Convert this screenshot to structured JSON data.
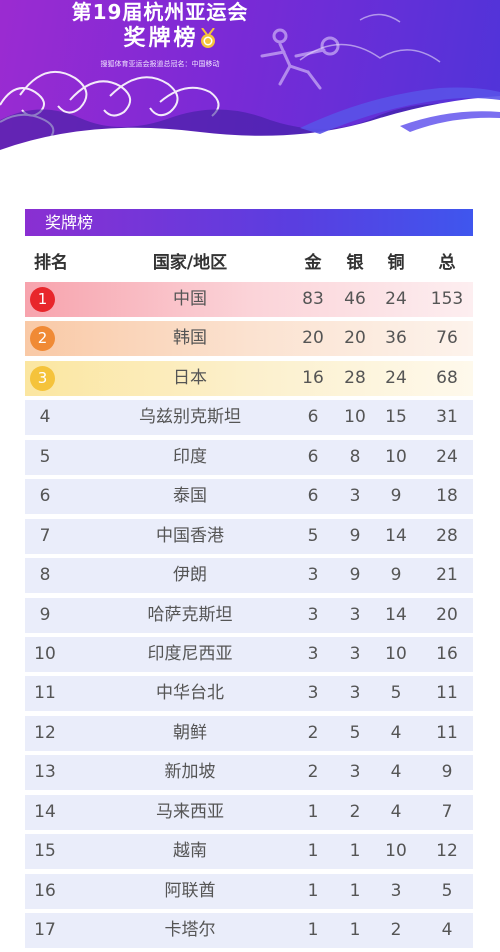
{
  "header": {
    "title": "第19届杭州亚运会",
    "subtitle": "奖牌榜",
    "sponsor": "搜狐体育亚运会报道总冠名：中国移动"
  },
  "table": {
    "title": "奖牌榜",
    "columns": {
      "rank": "排名",
      "country": "国家/地区",
      "gold": "金",
      "silver": "银",
      "bronze": "铜",
      "total": "总"
    },
    "rows": [
      {
        "rank": "1",
        "country": "中国",
        "gold": "83",
        "silver": "46",
        "bronze": "24",
        "total": "153"
      },
      {
        "rank": "2",
        "country": "韩国",
        "gold": "20",
        "silver": "20",
        "bronze": "36",
        "total": "76"
      },
      {
        "rank": "3",
        "country": "日本",
        "gold": "16",
        "silver": "28",
        "bronze": "24",
        "total": "68"
      },
      {
        "rank": "4",
        "country": "乌兹别克斯坦",
        "gold": "6",
        "silver": "10",
        "bronze": "15",
        "total": "31"
      },
      {
        "rank": "5",
        "country": "印度",
        "gold": "6",
        "silver": "8",
        "bronze": "10",
        "total": "24"
      },
      {
        "rank": "6",
        "country": "泰国",
        "gold": "6",
        "silver": "3",
        "bronze": "9",
        "total": "18"
      },
      {
        "rank": "7",
        "country": "中国香港",
        "gold": "5",
        "silver": "9",
        "bronze": "14",
        "total": "28"
      },
      {
        "rank": "8",
        "country": "伊朗",
        "gold": "3",
        "silver": "9",
        "bronze": "9",
        "total": "21"
      },
      {
        "rank": "9",
        "country": "哈萨克斯坦",
        "gold": "3",
        "silver": "3",
        "bronze": "14",
        "total": "20"
      },
      {
        "rank": "10",
        "country": "印度尼西亚",
        "gold": "3",
        "silver": "3",
        "bronze": "10",
        "total": "16"
      },
      {
        "rank": "11",
        "country": "中华台北",
        "gold": "3",
        "silver": "3",
        "bronze": "5",
        "total": "11"
      },
      {
        "rank": "12",
        "country": "朝鲜",
        "gold": "2",
        "silver": "5",
        "bronze": "4",
        "total": "11"
      },
      {
        "rank": "13",
        "country": "新加坡",
        "gold": "2",
        "silver": "3",
        "bronze": "4",
        "total": "9"
      },
      {
        "rank": "14",
        "country": "马来西亚",
        "gold": "1",
        "silver": "2",
        "bronze": "4",
        "total": "7"
      },
      {
        "rank": "15",
        "country": "越南",
        "gold": "1",
        "silver": "1",
        "bronze": "10",
        "total": "12"
      },
      {
        "rank": "16",
        "country": "阿联酋",
        "gold": "1",
        "silver": "1",
        "bronze": "3",
        "total": "5"
      },
      {
        "rank": "17",
        "country": "卡塔尔",
        "gold": "1",
        "silver": "1",
        "bronze": "2",
        "total": "4"
      }
    ]
  },
  "colors": {
    "row_bg": "#eaedfa",
    "rank1": "#e8262b",
    "rank2": "#f08a35",
    "rank3": "#f5c33b"
  },
  "icons": {
    "medal": "medal-icon",
    "sport": "table-tennis-player-icon"
  }
}
